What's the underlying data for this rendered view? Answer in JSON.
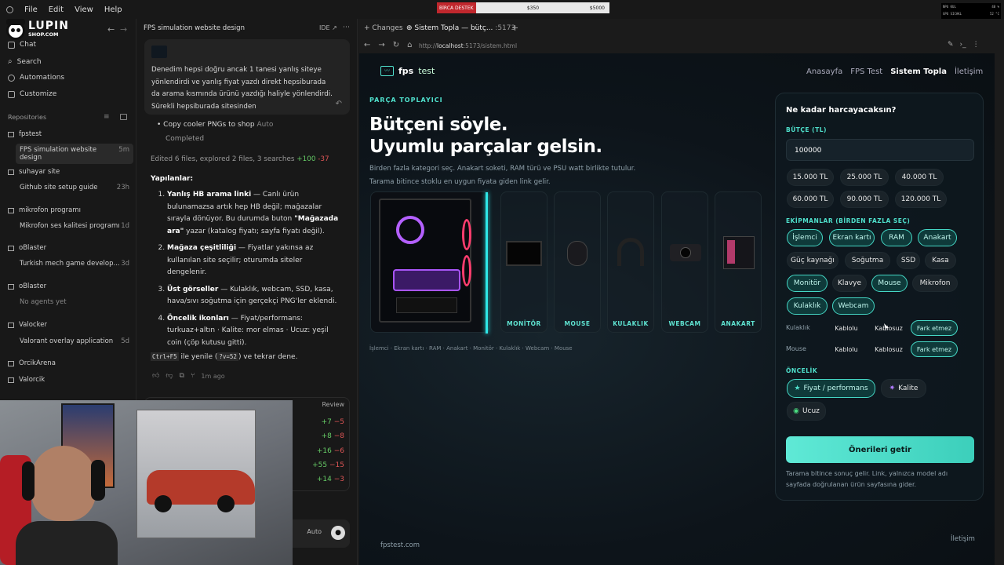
{
  "menubar": {
    "file": "File",
    "edit": "Edit",
    "view": "View",
    "help": "Help"
  },
  "donation": {
    "label": "BİRCA DESTEK",
    "current": "$350",
    "goal": "$5000"
  },
  "hwmon": {
    "rows": [
      [
        "NPU KUL",
        "48 %"
      ],
      [
        "GPU SICAKL",
        "52 °C"
      ],
      [
        "CPU KUL",
        "37 %"
      ],
      [
        "CPU TEMP",
        "71.5 °C"
      ]
    ]
  },
  "logo": {
    "text1": "LUPIN",
    "text2": "SHOP.COM"
  },
  "sidebar": {
    "new_chat": "Chat",
    "search": "Search",
    "automations": "Automations",
    "customize": "Customize",
    "repositories": "Repositories",
    "groups": [
      {
        "name": "fpstest",
        "threads": [
          {
            "title": "FPS simulation website design",
            "time": "5m"
          }
        ]
      },
      {
        "name": "suhayar site",
        "threads": [
          {
            "title": "Github site setup guide",
            "time": "23h"
          }
        ]
      },
      {
        "name": "mikrofon programı",
        "threads": [
          {
            "title": "Mikrofon ses kalitesi programı",
            "time": "1d"
          }
        ]
      },
      {
        "name": "oBlaster",
        "threads": [
          {
            "title": "Turkish mech game develop...",
            "time": "3d"
          }
        ]
      },
      {
        "name": "oBlaster",
        "threads": [
          {
            "title": "No agents yet",
            "time": ""
          }
        ]
      },
      {
        "name": "Valocker",
        "threads": [
          {
            "title": "Valorant overlay application",
            "time": "5d"
          }
        ]
      },
      {
        "name": "OrcikArena",
        "threads": []
      },
      {
        "name": "Valorcik",
        "threads": []
      }
    ]
  },
  "chat": {
    "title": "FPS simulation website design",
    "ide": "IDE",
    "user_msg": "Denedim hepsi doğru ancak 1 tanesi yanlış siteye yönlendirdi ve yanlış fiyat yazdı direkt hepsiburada da arama kısmında ürünü yazdığı haliyle yönlendirdi. Sürekli hepsiburada sitesinden",
    "task": "Copy cooler PNGs to shop",
    "task_badge": "Auto",
    "task_status": "Completed",
    "edited": "Edited 6 files, explored 2 files, 3 searches",
    "edited_add": "+100",
    "edited_del": "-37",
    "heading": "Yapılanlar:",
    "items": [
      {
        "bold": "Yanlış HB arama linki",
        "text": " — Canlı ürün bulunamazsa artık hep HB değil; mağazalar sırayla dönüyor. Bu durumda buton ",
        "bold2": "\"Mağazada ara\"",
        "text2": " yazar (katalog fiyatı; sayfa fiyatı değil)."
      },
      {
        "bold": "Mağaza çeşitliliği",
        "text": " — Fiyatlar yakınsa az kullanılan site seçilir; oturumda siteler dengelenir.",
        "bold2": "",
        "text2": ""
      },
      {
        "bold": "Üst görseller",
        "text": " — Kulaklık, webcam, SSD, kasa, hava/sıvı soğutma için gerçekçi PNG'ler eklendi.",
        "bold2": "",
        "text2": ""
      },
      {
        "bold": "Öncelik ikonları",
        "text": " — Fiyat/performans: turkuaz+altın · Kalite: mor elmas · Ucuz: yeşil coin (çöp kutusu gitti).",
        "bold2": "",
        "text2": ""
      }
    ],
    "footer_code": "Ctrl+F5",
    "footer_mid": " ile yenile (",
    "footer_code2": "?v=52",
    "footer_end": ") ve tekrar dene.",
    "time": "1m ago",
    "review": "Review",
    "diffs": [
      [
        "+7",
        "−5"
      ],
      [
        "+8",
        "−8"
      ],
      [
        "+16",
        "−6"
      ],
      [
        "+55",
        "−15"
      ],
      [
        "+14",
        "−3"
      ]
    ],
    "mode": "Auto"
  },
  "browser": {
    "changes": "Changes",
    "tab_title": "Sistem Topla — bütç...",
    "tab_port": ":5173",
    "url_prefix": "http://",
    "url_host": "localhost",
    "url_rest": ":5173/sistem.html"
  },
  "site": {
    "brand_bold": "fps",
    "brand_light": "test",
    "nav": [
      "Anasayfa",
      "FPS Test",
      "Sistem Topla",
      "İletişim"
    ],
    "eyebrow": "PARÇA TOPLAYICI",
    "h1_line1": "Bütçeni söyle.",
    "h1_line2": "Uyumlu parçalar gelsin.",
    "sub1": "Birden fazla kategori seç. Anakart soketi, RAM türü ve PSU watt birlikte tutulur.",
    "sub2": "Tarama bitince stoklu en uygun fiyata giden link gelir.",
    "cards": [
      "MONİTÖR",
      "MOUSE",
      "KULAKLIK",
      "WEBCAM",
      "ANAKART"
    ],
    "selected_summary": "İşlemci · Ekran kartı · RAM · Anakart · Monitör · Kulaklık · Webcam · Mouse",
    "footer_brand": "fpstest.com",
    "footer_link": "İletişim",
    "panel": {
      "title": "Ne kadar harcayacaksın?",
      "budget_label": "BÜTÇE (TL)",
      "budget_value": "100000",
      "presets": [
        "15.000 TL",
        "25.000 TL",
        "40.000 TL",
        "60.000 TL",
        "90.000 TL",
        "120.000 TL"
      ],
      "equip_label": "EKİPMANLAR (BİRDEN FAZLA SEÇ)",
      "equip": [
        "İşlemci",
        "Ekran kartı",
        "RAM",
        "Anakart",
        "Güç kaynağı",
        "Soğutma",
        "SSD",
        "Kasa",
        "Monitör",
        "Klavye",
        "Mouse",
        "Mikrofon",
        "Kulaklık",
        "Webcam"
      ],
      "equip_selected": [
        true,
        true,
        true,
        true,
        false,
        false,
        false,
        false,
        true,
        false,
        true,
        false,
        true,
        true
      ],
      "headset_label": "Kulaklık",
      "mouse_label": "Mouse",
      "opts": [
        "Kablolu",
        "Kablosuz",
        "Fark etmez"
      ],
      "priority_label": "ÖNCELİK",
      "priorities": [
        "Fiyat / performans",
        "Kalite",
        "Ucuz"
      ],
      "cta": "Önerileri getir",
      "note": "Tarama bitince sonuç gelir. Link, yalnızca model adı sayfada doğrulanan ürün sayfasına gider."
    }
  },
  "colors": {
    "accent": "#4fe0cc",
    "bg": "#0d141a",
    "panel": "#111b21"
  }
}
